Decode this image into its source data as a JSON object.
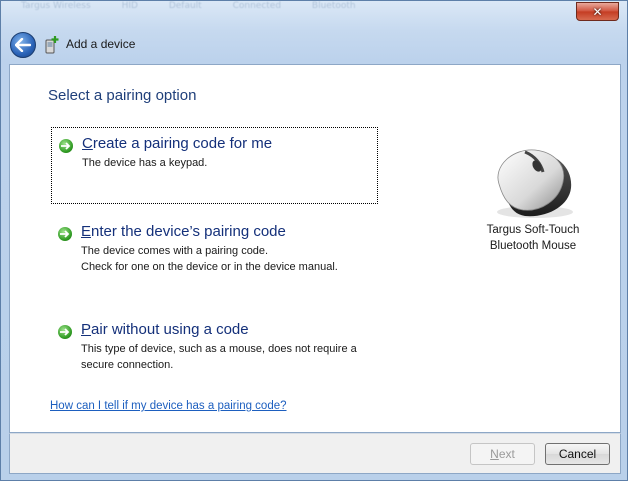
{
  "window": {
    "title": "Add a device",
    "background_rows": [
      "Targus Wireless",
      "Keyboard",
      "HID",
      "Default",
      "Connected",
      "Bluetooth"
    ]
  },
  "heading": "Select a pairing option",
  "options": [
    {
      "title_accel": "C",
      "title_rest": "reate a pairing code for me",
      "desc_lines": [
        "The device has a keypad."
      ]
    },
    {
      "title_accel": "E",
      "title_rest": "nter the device’s pairing code",
      "desc_lines": [
        "The device comes with a pairing code.",
        "Check for one on the device or in the device manual."
      ]
    },
    {
      "title_accel": "P",
      "title_rest": "air without using a code",
      "desc_lines": [
        "This type of device, such as a mouse, does not require a",
        "secure connection."
      ]
    }
  ],
  "device": {
    "name_line1": "Targus Soft-Touch",
    "name_line2": "Bluetooth Mouse",
    "icon": "mouse-icon"
  },
  "help_link": "How can I tell if my device has a pairing code?",
  "buttons": {
    "next_accel": "N",
    "next_rest": "ext",
    "cancel": "Cancel"
  },
  "icons": {
    "close": "close-icon",
    "back": "back-arrow-icon",
    "title": "add-device-icon",
    "option_arrow": "green-arrow-icon"
  },
  "colors": {
    "heading": "#1f3f7a",
    "option_title": "#14307a",
    "link": "#1d5fbf",
    "close_button": "#c43b22"
  }
}
